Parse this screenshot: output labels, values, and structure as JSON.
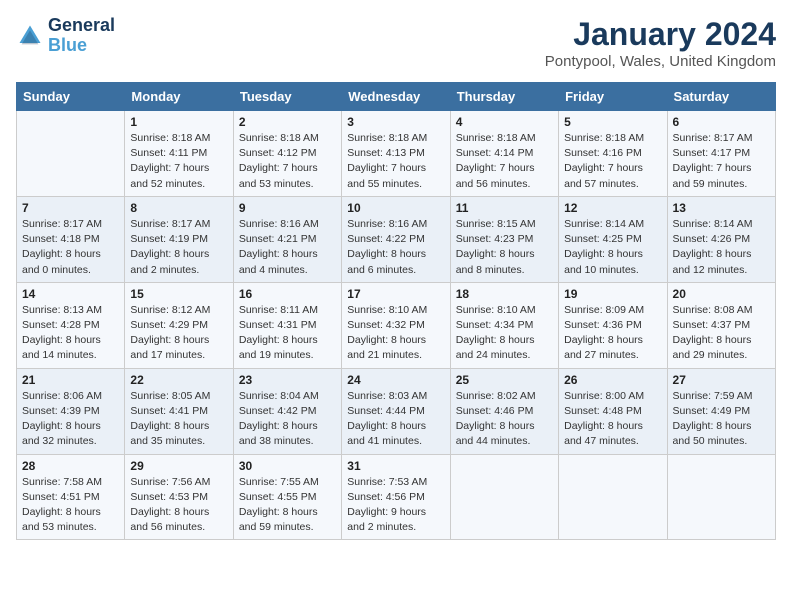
{
  "logo": {
    "line1": "General",
    "line2": "Blue"
  },
  "title": "January 2024",
  "subtitle": "Pontypool, Wales, United Kingdom",
  "days_of_week": [
    "Sunday",
    "Monday",
    "Tuesday",
    "Wednesday",
    "Thursday",
    "Friday",
    "Saturday"
  ],
  "weeks": [
    [
      {
        "num": "",
        "info": ""
      },
      {
        "num": "1",
        "info": "Sunrise: 8:18 AM\nSunset: 4:11 PM\nDaylight: 7 hours\nand 52 minutes."
      },
      {
        "num": "2",
        "info": "Sunrise: 8:18 AM\nSunset: 4:12 PM\nDaylight: 7 hours\nand 53 minutes."
      },
      {
        "num": "3",
        "info": "Sunrise: 8:18 AM\nSunset: 4:13 PM\nDaylight: 7 hours\nand 55 minutes."
      },
      {
        "num": "4",
        "info": "Sunrise: 8:18 AM\nSunset: 4:14 PM\nDaylight: 7 hours\nand 56 minutes."
      },
      {
        "num": "5",
        "info": "Sunrise: 8:18 AM\nSunset: 4:16 PM\nDaylight: 7 hours\nand 57 minutes."
      },
      {
        "num": "6",
        "info": "Sunrise: 8:17 AM\nSunset: 4:17 PM\nDaylight: 7 hours\nand 59 minutes."
      }
    ],
    [
      {
        "num": "7",
        "info": "Sunrise: 8:17 AM\nSunset: 4:18 PM\nDaylight: 8 hours\nand 0 minutes."
      },
      {
        "num": "8",
        "info": "Sunrise: 8:17 AM\nSunset: 4:19 PM\nDaylight: 8 hours\nand 2 minutes."
      },
      {
        "num": "9",
        "info": "Sunrise: 8:16 AM\nSunset: 4:21 PM\nDaylight: 8 hours\nand 4 minutes."
      },
      {
        "num": "10",
        "info": "Sunrise: 8:16 AM\nSunset: 4:22 PM\nDaylight: 8 hours\nand 6 minutes."
      },
      {
        "num": "11",
        "info": "Sunrise: 8:15 AM\nSunset: 4:23 PM\nDaylight: 8 hours\nand 8 minutes."
      },
      {
        "num": "12",
        "info": "Sunrise: 8:14 AM\nSunset: 4:25 PM\nDaylight: 8 hours\nand 10 minutes."
      },
      {
        "num": "13",
        "info": "Sunrise: 8:14 AM\nSunset: 4:26 PM\nDaylight: 8 hours\nand 12 minutes."
      }
    ],
    [
      {
        "num": "14",
        "info": "Sunrise: 8:13 AM\nSunset: 4:28 PM\nDaylight: 8 hours\nand 14 minutes."
      },
      {
        "num": "15",
        "info": "Sunrise: 8:12 AM\nSunset: 4:29 PM\nDaylight: 8 hours\nand 17 minutes."
      },
      {
        "num": "16",
        "info": "Sunrise: 8:11 AM\nSunset: 4:31 PM\nDaylight: 8 hours\nand 19 minutes."
      },
      {
        "num": "17",
        "info": "Sunrise: 8:10 AM\nSunset: 4:32 PM\nDaylight: 8 hours\nand 21 minutes."
      },
      {
        "num": "18",
        "info": "Sunrise: 8:10 AM\nSunset: 4:34 PM\nDaylight: 8 hours\nand 24 minutes."
      },
      {
        "num": "19",
        "info": "Sunrise: 8:09 AM\nSunset: 4:36 PM\nDaylight: 8 hours\nand 27 minutes."
      },
      {
        "num": "20",
        "info": "Sunrise: 8:08 AM\nSunset: 4:37 PM\nDaylight: 8 hours\nand 29 minutes."
      }
    ],
    [
      {
        "num": "21",
        "info": "Sunrise: 8:06 AM\nSunset: 4:39 PM\nDaylight: 8 hours\nand 32 minutes."
      },
      {
        "num": "22",
        "info": "Sunrise: 8:05 AM\nSunset: 4:41 PM\nDaylight: 8 hours\nand 35 minutes."
      },
      {
        "num": "23",
        "info": "Sunrise: 8:04 AM\nSunset: 4:42 PM\nDaylight: 8 hours\nand 38 minutes."
      },
      {
        "num": "24",
        "info": "Sunrise: 8:03 AM\nSunset: 4:44 PM\nDaylight: 8 hours\nand 41 minutes."
      },
      {
        "num": "25",
        "info": "Sunrise: 8:02 AM\nSunset: 4:46 PM\nDaylight: 8 hours\nand 44 minutes."
      },
      {
        "num": "26",
        "info": "Sunrise: 8:00 AM\nSunset: 4:48 PM\nDaylight: 8 hours\nand 47 minutes."
      },
      {
        "num": "27",
        "info": "Sunrise: 7:59 AM\nSunset: 4:49 PM\nDaylight: 8 hours\nand 50 minutes."
      }
    ],
    [
      {
        "num": "28",
        "info": "Sunrise: 7:58 AM\nSunset: 4:51 PM\nDaylight: 8 hours\nand 53 minutes."
      },
      {
        "num": "29",
        "info": "Sunrise: 7:56 AM\nSunset: 4:53 PM\nDaylight: 8 hours\nand 56 minutes."
      },
      {
        "num": "30",
        "info": "Sunrise: 7:55 AM\nSunset: 4:55 PM\nDaylight: 8 hours\nand 59 minutes."
      },
      {
        "num": "31",
        "info": "Sunrise: 7:53 AM\nSunset: 4:56 PM\nDaylight: 9 hours\nand 2 minutes."
      },
      {
        "num": "",
        "info": ""
      },
      {
        "num": "",
        "info": ""
      },
      {
        "num": "",
        "info": ""
      }
    ]
  ]
}
